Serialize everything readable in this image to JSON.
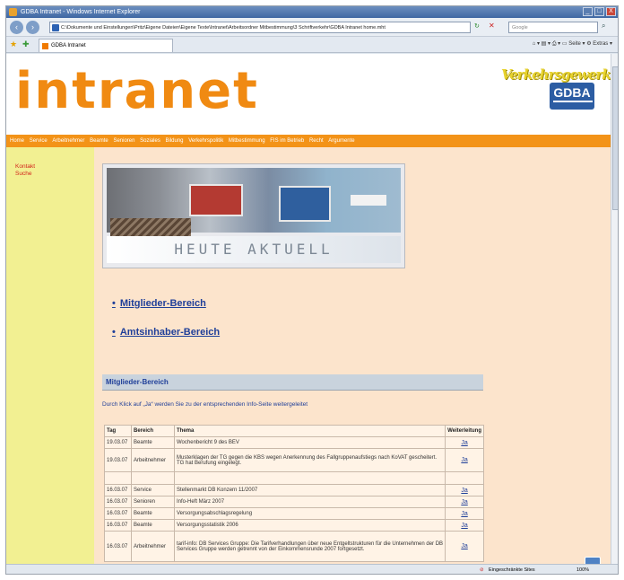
{
  "window": {
    "title": "GDBA Intranet - Windows Internet Explorer",
    "controls": [
      "_",
      "□",
      "X"
    ]
  },
  "address": {
    "url": "C:\\Dokumente und Einstellungen\\Pritz\\Eigene Dateien\\Eigene Texte\\Intranet\\Arbeitsordner Mitbestimmung\\3 Schriftverkehr\\GDBA Intranet home.mht",
    "search_placeholder": "Google"
  },
  "tab": {
    "label": "GDBA Intranet"
  },
  "toolbar": {
    "page_label": "Seite",
    "extras_label": "Extras"
  },
  "site": {
    "logo": "intranet",
    "brand_text": "Verkehrsgewerkschaft",
    "brand_abbr": "GDBA",
    "nav": [
      "Home",
      "Service",
      "Arbeitnehmer",
      "Beamte",
      "Senioren",
      "Soziales",
      "Bildung",
      "Verkehrspolitik",
      "Mitbestimmung",
      "FIS im Betrieb",
      "Recht",
      "Argumente"
    ],
    "sidebar": [
      "Kontakt",
      "Suche"
    ],
    "banner_caption": "HEUTE AKTUELL",
    "links": [
      "Mitglieder-Bereich",
      "Amtsinhaber-Bereich"
    ],
    "section_title": "Mitglieder-Bereich",
    "intro": "Durch Klick auf „Ja“ werden Sie zu der entsprechenden Info-Seite weitergeleitet",
    "table": {
      "headers": [
        "Tag",
        "Bereich",
        "Thema",
        "Weiterleitung"
      ],
      "rows": [
        {
          "tag": "19.03.07",
          "bereich": "Beamte",
          "thema": "Wochenbericht 9 des BEV",
          "link": "Ja"
        },
        {
          "tag": "19.03.07",
          "bereich": "Arbeitnehmer",
          "thema": "Musterklagen der TG gegen die KBS wegen Anerkennung des Fallgruppenaufstiegs nach KoVAT gescheitert. TG hat Berufung eingelegt.",
          "link": "Ja"
        },
        {
          "tag": "",
          "bereich": "",
          "thema": "",
          "link": ""
        },
        {
          "tag": "16.03.07",
          "bereich": "Service",
          "thema": "Stellenmarkt DB Konzern 11/2007",
          "link": "Ja"
        },
        {
          "tag": "16.03.07",
          "bereich": "Senioren",
          "thema": "Info-Heft März 2007",
          "link": "Ja"
        },
        {
          "tag": "16.03.07",
          "bereich": "Beamte",
          "thema": "Versorgungsabschlagsregelung",
          "link": "Ja"
        },
        {
          "tag": "16.03.07",
          "bereich": "Beamte",
          "thema": "Versorgungsstatistik 2006",
          "link": "Ja"
        },
        {
          "tag": "16.03.07",
          "bereich": "Arbeitnehmer",
          "thema": "tarif-info: DB Services Gruppe: Die Tarifverhandlungen über neue Entgeltstrukturen für die Unternehmen der DB Services Gruppe werden getrennt von der Einkommensrunde 2007 fortgesetzt.",
          "link": "Ja"
        }
      ]
    }
  },
  "status": {
    "zone": "Eingeschränkte Sites",
    "zoom": "100%"
  },
  "colors": {
    "brand_orange": "#f08a12",
    "sidebar_yellow": "#f2f092",
    "main_peach": "#fce4cc",
    "link_blue": "#1f3f99"
  }
}
